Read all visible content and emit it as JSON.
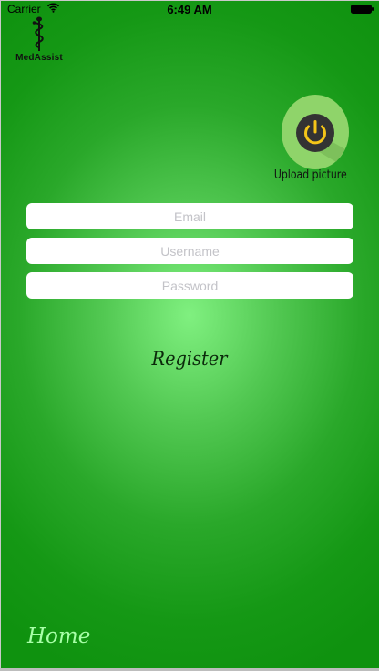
{
  "status_bar": {
    "carrier": "Carrier",
    "time": "6:49 AM",
    "icons": [
      "wifi-icon",
      "battery-icon"
    ]
  },
  "app": {
    "logo_text": "MedAssist",
    "logo_icon": "caduceus-icon"
  },
  "upload": {
    "label": "Upload picture",
    "icon": "power-icon",
    "icon_color": "#f5c518",
    "circle_color": "#8fd46a"
  },
  "form": {
    "email": {
      "placeholder": "Email",
      "value": ""
    },
    "username": {
      "placeholder": "Username",
      "value": ""
    },
    "password": {
      "placeholder": "Password",
      "value": ""
    }
  },
  "actions": {
    "register_label": "Register",
    "home_label": "Home"
  },
  "colors": {
    "background_center": "#80f080",
    "background_edge": "#0f920f",
    "home_text": "#a8ffa8",
    "register_text": "#0b2a0b"
  }
}
